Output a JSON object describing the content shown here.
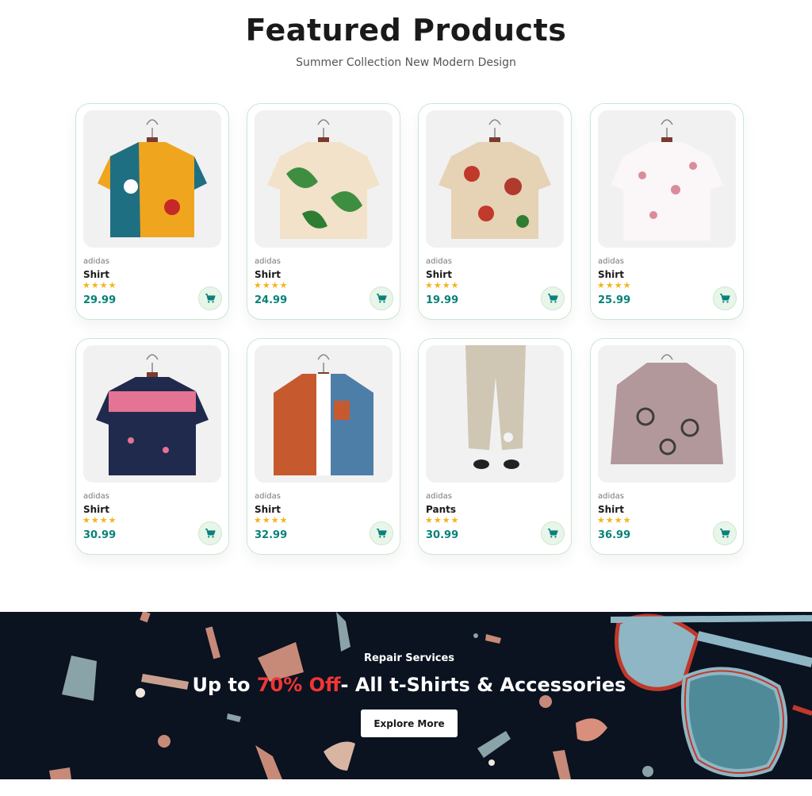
{
  "section": {
    "title": "Featured Products",
    "subtitle": "Summer Collection New Modern Design"
  },
  "products": [
    {
      "brand": "adidas",
      "name": "Shirt",
      "stars": "★★★★",
      "price": "29.99",
      "image_icon": "hawaiian-shirt-yellow-teal-icon"
    },
    {
      "brand": "adidas",
      "name": "Shirt",
      "stars": "★★★★",
      "price": "24.99",
      "image_icon": "hawaiian-shirt-green-leaf-icon"
    },
    {
      "brand": "adidas",
      "name": "Shirt",
      "stars": "★★★★",
      "price": "19.99",
      "image_icon": "hawaiian-shirt-red-floral-icon"
    },
    {
      "brand": "adidas",
      "name": "Shirt",
      "stars": "★★★★",
      "price": "25.99",
      "image_icon": "white-pink-floral-shirt-icon"
    },
    {
      "brand": "adidas",
      "name": "Shirt",
      "stars": "★★★★",
      "price": "30.99",
      "image_icon": "navy-floral-shirt-icon"
    },
    {
      "brand": "adidas",
      "name": "Shirt",
      "stars": "★★★★",
      "price": "32.99",
      "image_icon": "orange-denim-overshirt-icon"
    },
    {
      "brand": "adidas",
      "name": "Pants",
      "stars": "★★★★",
      "price": "30.99",
      "image_icon": "beige-linen-pants-icon"
    },
    {
      "brand": "adidas",
      "name": "Shirt",
      "stars": "★★★★",
      "price": "36.99",
      "image_icon": "pink-paisley-blouse-icon"
    }
  ],
  "cart_icon": "cart-icon",
  "banner": {
    "kicker": "Repair Services",
    "headline_prefix": "Up to ",
    "headline_highlight": "70% Off",
    "headline_suffix": "- All t-Shirts & Accessories",
    "button_label": "Explore More"
  },
  "colors": {
    "accent": "#088178",
    "star": "#f3b519",
    "highlight": "#ef3636",
    "banner_bg": "#0b1220",
    "card_border": "#cce7d0"
  }
}
